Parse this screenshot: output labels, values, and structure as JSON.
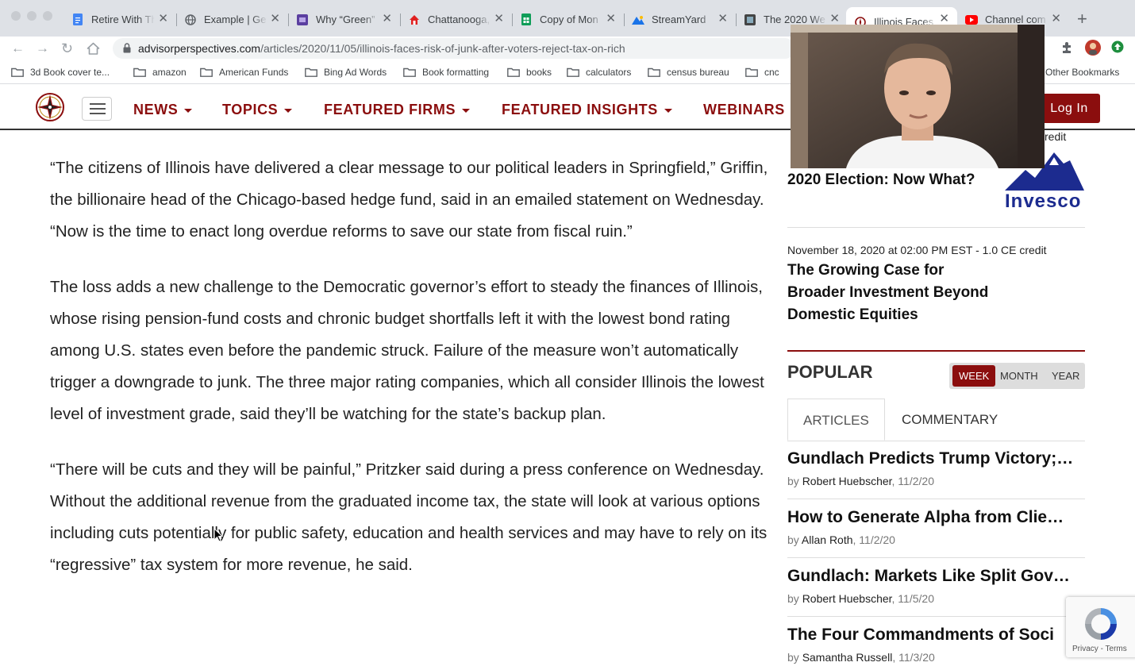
{
  "browser": {
    "tabs": [
      {
        "title": "Retire With The",
        "icon": "google-docs-icon",
        "color": "#4285f4"
      },
      {
        "title": "Example | Ge",
        "icon": "globe-icon",
        "color": "#5f6368"
      },
      {
        "title": "Why “Green”",
        "icon": "site-icon",
        "color": "#5b3fa0"
      },
      {
        "title": "Chattanooga,",
        "icon": "house-icon",
        "color": "#e02020"
      },
      {
        "title": "Copy of Mon",
        "icon": "google-sheets-icon",
        "color": "#0f9d58"
      },
      {
        "title": "StreamYard",
        "icon": "streamyard-icon",
        "color": "#1a73e8"
      },
      {
        "title": "The 2020 We",
        "icon": "film-icon",
        "color": "#444"
      },
      {
        "title": "Illinois Faces",
        "icon": "compass-icon",
        "color": "#8b0e0e"
      },
      {
        "title": "Channel com",
        "icon": "youtube-icon",
        "color": "#ff0000"
      }
    ],
    "url_host": "advisorperspectives.com",
    "url_path": "/articles/2020/11/05/illinois-faces-risk-of-junk-after-voters-reject-tax-on-rich",
    "bookmarks": [
      "3d Book cover te...",
      "amazon",
      "American Funds",
      "Bing Ad Words",
      "Book formatting",
      "books",
      "calculators",
      "census bureau",
      "cnc"
    ],
    "other_bookmarks": "Other Bookmarks"
  },
  "site": {
    "nav": [
      "NEWS",
      "TOPICS",
      "FEATURED FIRMS",
      "FEATURED INSIGHTS",
      "WEBINARS"
    ],
    "login": "Log In"
  },
  "article": {
    "paragraphs": [
      "“The citizens of Illinois have delivered a clear message to our political leaders in Springfield,” Griffin, the billionaire head of the Chicago-based hedge fund, said in an emailed statement on Wednesday. “Now is the time to enact long overdue reforms to save our state from fiscal ruin.”",
      "The loss adds a new challenge to the Democratic governor’s effort to steady the finances of Illinois, whose rising pension-fund costs and chronic budget shortfalls left it with the lowest bond rating among U.S. states even before the pandemic struck. Failure of the measure won’t automatically trigger a downgrade to junk. The three major rating companies, which all consider Illinois the lowest level of investment grade, said they’ll be watching for the state’s backup plan.",
      "“There will be cuts and they will be painful,” Pritzker said during a press conference on Wednesday. Without the additional revenue from the graduated income tax, the state will look at various options including cuts potentially for public safety, education and health services and may have to rely on its “regressive” tax system for more revenue, he said."
    ]
  },
  "sidebar": {
    "webinar1": {
      "meta_tail": "redit",
      "title": "2020 Election: Now What?",
      "sponsor": "Invesco"
    },
    "webinar2": {
      "meta": "November 18, 2020 at 02:00 PM EST - 1.0 CE credit",
      "title": "The Growing Case for Broader Investment Beyond Domestic Equities"
    },
    "popular_title": "POPULAR",
    "periods": [
      "WEEK",
      "MONTH",
      "YEAR"
    ],
    "tabs": [
      "ARTICLES",
      "COMMENTARY"
    ],
    "items": [
      {
        "title": "Gundlach Predicts Trump Victory;…",
        "author": "Robert Huebscher",
        "date": ", 11/2/20"
      },
      {
        "title": "How to Generate Alpha from Clie…",
        "author": "Allan Roth",
        "date": ", 11/2/20"
      },
      {
        "title": "Gundlach: Markets Like Split Gov…",
        "author": "Robert Huebscher",
        "date": ", 11/5/20"
      },
      {
        "title": "The Four Commandments of Soci",
        "author": "Samantha Russell",
        "date": ", 11/3/20"
      }
    ],
    "by": "by"
  },
  "recaptcha": {
    "privacy": "Privacy",
    "terms": "Terms",
    "sep": " - "
  }
}
